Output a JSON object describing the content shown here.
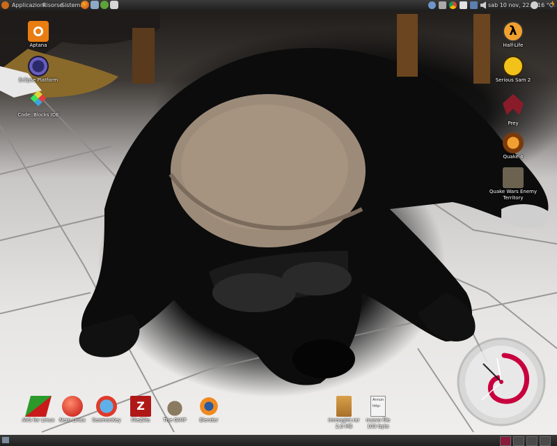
{
  "top_panel": {
    "menus": [
      "Applicazioni",
      "Risorse",
      "Sistema"
    ],
    "launchers": [
      "firefox-icon",
      "file-manager-icon",
      "messenger-icon",
      "mail-icon"
    ],
    "tray_icons": [
      "user-icon",
      "screen-icon",
      "chrome-icon",
      "mail-tray-icon",
      "network-icon",
      "volume-icon"
    ],
    "clock": "sab 10 nov, 22.44",
    "weather": "16 °C"
  },
  "desktop_icons_left": [
    {
      "label": "Aptana",
      "icon": "aptana-icon"
    },
    {
      "label": "Eclipse Platform",
      "icon": "eclipse-icon"
    },
    {
      "label": "Code::Blocks IDE",
      "icon": "codeblocks-icon"
    }
  ],
  "desktop_icons_right": [
    {
      "label": "Half-Life",
      "icon": "half-life-icon"
    },
    {
      "label": "Serious Sam 2",
      "icon": "serious-sam-icon"
    },
    {
      "label": "Prey",
      "icon": "prey-icon"
    },
    {
      "label": "Quake 4",
      "icon": "quake4-icon"
    },
    {
      "label": "Quake Wars Enemy Territory",
      "icon": "quake-wars-icon"
    }
  ],
  "desktop_icons_bottom": [
    {
      "label": "AVS for Linux",
      "icon": "avs-icon"
    },
    {
      "label": "Nero Linux",
      "icon": "nero-icon"
    },
    {
      "label": "SeamonKey",
      "icon": "seamonkey-icon"
    },
    {
      "label": "FileZilla",
      "icon": "filezilla-icon"
    },
    {
      "label": "The GIMP",
      "icon": "gimp-icon"
    },
    {
      "label": "Blender",
      "icon": "blender-icon"
    }
  ],
  "desktop_files": [
    {
      "label": "Immagini.rar",
      "size": "2,6 MB",
      "icon": "archive-icon"
    },
    {
      "label": "nuovo file",
      "size": "103 byte",
      "icon": "text-file-icon",
      "preview_lines": [
        "Annun",
        "http:"
      ]
    }
  ],
  "clock_widget": {
    "icon": "debian-clock-icon"
  },
  "bottom_panel": {
    "workspaces": 4,
    "active_workspace": 1
  }
}
